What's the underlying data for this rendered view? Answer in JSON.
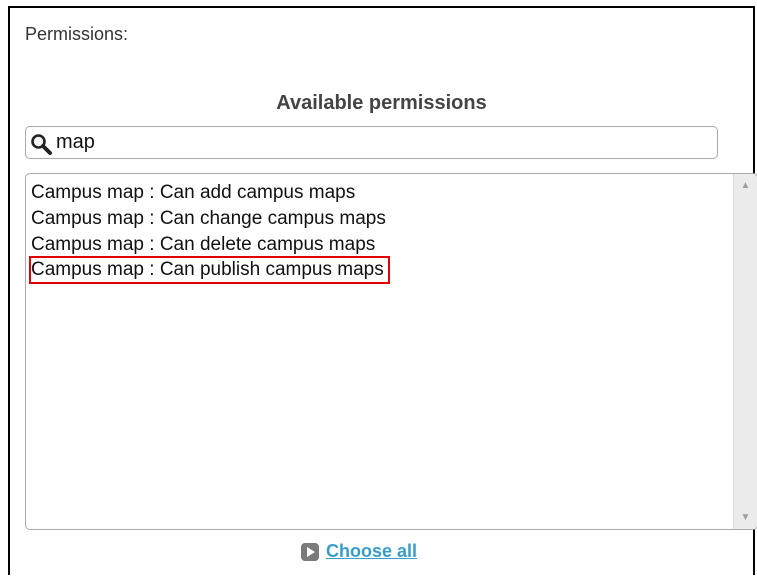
{
  "permissions_label": "Permissions:",
  "available": {
    "heading": "Available permissions",
    "filter": {
      "value": "map",
      "placeholder": "",
      "icon": "search-icon"
    },
    "options": [
      "Campus map : Can add campus maps",
      "Campus map : Can change campus maps",
      "Campus map : Can delete campus maps",
      "Campus map : Can publish campus maps"
    ],
    "highlighted_index": 3,
    "highlight_color": "#e00000"
  },
  "choose_all": {
    "label": "Choose all",
    "icon": "play-icon",
    "color": "#3a9cc9"
  }
}
